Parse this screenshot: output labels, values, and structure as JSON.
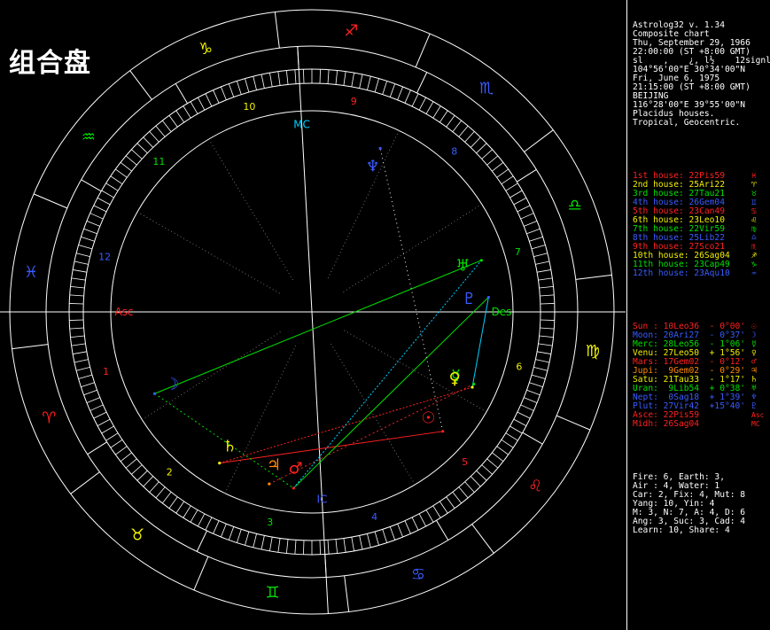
{
  "title": "组合盘",
  "header": [
    "Astrolog32 v. 1.34",
    "Composite chart",
    "Thu, September 29, 1966",
    "22:00:00 (ST +8:00 GMT)",
    "sl    ,    ¿, l½    12signl",
    "104°56'00\"E 30°34'00\"N",
    "Fri, June 6, 1975",
    "21:15:00 (ST +8:00 GMT)",
    "BEIJING",
    "116°28'00\"E 39°55'00\"N",
    "Placidus houses.",
    "Tropical, Geocentric."
  ],
  "houses": [
    {
      "text": "1st house: 22Pis59",
      "color": "red",
      "symbol": "♓"
    },
    {
      "text": "2nd house: 25Ari22",
      "color": "yellow",
      "symbol": "♈"
    },
    {
      "text": "3rd house: 27Tau21",
      "color": "green",
      "symbol": "♉"
    },
    {
      "text": "4th house: 26Gem04",
      "color": "blue",
      "symbol": "♊"
    },
    {
      "text": "5th house: 23Can49",
      "color": "red",
      "symbol": "♋"
    },
    {
      "text": "6th house: 23Leo10",
      "color": "yellow",
      "symbol": "♌"
    },
    {
      "text": "7th house: 22Vir59",
      "color": "green",
      "symbol": "♍"
    },
    {
      "text": "8th house: 25Lib22",
      "color": "blue",
      "symbol": "♎"
    },
    {
      "text": "9th house: 27Sco21",
      "color": "red",
      "symbol": "♏"
    },
    {
      "text": "10th house: 26Sag04",
      "color": "yellow",
      "symbol": "♐"
    },
    {
      "text": "11th house: 23Cap49",
      "color": "green",
      "symbol": "♑"
    },
    {
      "text": "12th house: 23Aqu10",
      "color": "blue",
      "symbol": "♒"
    }
  ],
  "planets": [
    {
      "text": "Sun : 10Leo36  - 0°00'",
      "color": "red",
      "symbol": "☉"
    },
    {
      "text": "Moon: 20Ari27  - 0°37'",
      "color": "blue",
      "symbol": "☽"
    },
    {
      "text": "Merc: 28Leo56  - 1°06'",
      "color": "green",
      "symbol": "☿"
    },
    {
      "text": "Venu: 27Leo50  + 1°56'",
      "color": "yellow",
      "symbol": "♀"
    },
    {
      "text": "Mars: 17Gem02  - 0°12'",
      "color": "red",
      "symbol": "♂"
    },
    {
      "text": "Jupi:  9Gem02  - 0°29'",
      "color": "orange",
      "symbol": "♃"
    },
    {
      "text": "Satu: 21Tau33  - 1°17'",
      "color": "yellow",
      "symbol": "♄"
    },
    {
      "text": "Uran:  9Lib54  + 0°38'",
      "color": "green",
      "symbol": "♅"
    },
    {
      "text": "Nept:  0Sag18  + 1°39'",
      "color": "blue",
      "symbol": "♆"
    },
    {
      "text": "Plut: 27Vir42  +15°40'",
      "color": "blue",
      "symbol": "♇"
    },
    {
      "text": "Asce: 22Pis59",
      "color": "red",
      "symbol": "Asc"
    },
    {
      "text": "Midh: 26Sag04",
      "color": "red",
      "symbol": "MC"
    }
  ],
  "stats": [
    "Fire: 6, Earth: 3,",
    "Air : 4, Water: 1",
    "Car: 2, Fix: 4, Mut: 8",
    "Yang: 10, Yin: 4",
    "M: 3, N: 7, A: 4, D: 6",
    "Ang: 3, Suc: 3, Cad: 4",
    "Learn: 10, Share: 4"
  ],
  "colors": {
    "red": "#ff2020",
    "orange": "#ff8a00",
    "green": "#00e000",
    "yellow": "#f0f000",
    "blue": "#3a5cff",
    "cyan": "#00d0ff",
    "white": "#ffffff",
    "magenta": "#ff40ff",
    "lime": "#a8ff00"
  },
  "wheel": {
    "house_numbers": [
      "1",
      "2",
      "3",
      "4",
      "5",
      "6",
      "7",
      "8",
      "9",
      "10",
      "11",
      "12"
    ],
    "axis_labels": {
      "asc": "Asc",
      "des": "Des",
      "mc": "MC",
      "ic": "IC"
    },
    "sign_glyphs": [
      "♈",
      "♉",
      "♊",
      "♋",
      "♌",
      "♍",
      "♎",
      "♏",
      "♐",
      "♑",
      "♒",
      "♓"
    ],
    "planet_glyphs": [
      "☉",
      "☽",
      "☿",
      "♀",
      "♂",
      "♃",
      "♄",
      "♅",
      "♆",
      "♇"
    ]
  }
}
